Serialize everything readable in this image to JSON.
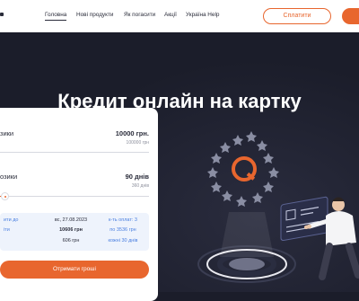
{
  "header": {
    "nav": [
      {
        "label": "Головна",
        "active": true
      },
      {
        "label": "Нові продукти",
        "active": false
      },
      {
        "label": "Як погасити",
        "active": false
      },
      {
        "label": "Акції",
        "active": false
      },
      {
        "label": "Україна Help",
        "active": false
      }
    ],
    "pay_button": "Сплатити"
  },
  "hero": {
    "title": "Кредит онлайн на картку"
  },
  "calculator": {
    "amount": {
      "label": "зики",
      "value": "10000 грн.",
      "max": "100000 грн",
      "percent": 10
    },
    "term": {
      "label": "озики",
      "value": "90 днів",
      "max": "360 днів",
      "percent": 25
    },
    "info": {
      "col1": [
        "ити до",
        "іти"
      ],
      "col2": [
        "вс, 27.08.2023",
        "10606 грн",
        "606 грн"
      ],
      "col3": [
        "к-ть оплат: 3",
        "по 3536 грн",
        "кожні 30 днів"
      ]
    },
    "submit_button": "Отримати гроші"
  },
  "colors": {
    "accent": "#e8662e",
    "background": "#1b1d2a",
    "link": "#4a7fe0"
  }
}
